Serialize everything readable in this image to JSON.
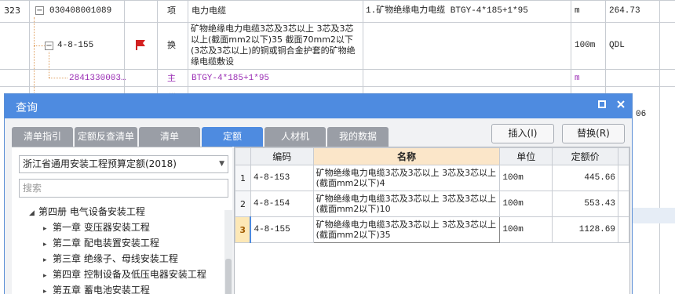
{
  "bg_rows": [
    {
      "no": "323",
      "code": "030408001089",
      "type": "项",
      "name": "电力电缆",
      "feature": "1.矿物绝缘电力电缆 BTGY-4*185+1*95",
      "unit": "m",
      "qty": "264.73"
    },
    {
      "code": "4-8-155",
      "type": "换",
      "name": "矿物绝缘电力电缆3芯及3芯以上 3芯及3芯以上(截面mm2以下)35  截面70mm2以下(3芯及3芯以上)的铜或铜合金护套的矿物绝缘电缆敷设",
      "unit": "100m",
      "qty": "QDL"
    },
    {
      "code": "2841330003…",
      "type": "主",
      "name": "BTGY-4*185+1*95",
      "unit": "m"
    }
  ],
  "bg_partial": {
    "row4_type": "…",
    "right_edge_num": "06"
  },
  "dialog": {
    "title": "查询",
    "restore_label": "▫",
    "close_label": "✕",
    "tabs": [
      "清单指引",
      "定额反查清单",
      "清单",
      "定额",
      "人材机",
      "我的数据"
    ],
    "active_tab": "定额",
    "insert_label": "插入(I)",
    "replace_label": "替换(R)",
    "quota_library": "浙江省通用安装工程预算定额(2018)",
    "search_placeholder": "搜索",
    "tree": [
      {
        "label": "第四册 电气设备安装工程",
        "level": 0,
        "expanded": true
      },
      {
        "label": "第一章 变压器安装工程",
        "level": 1
      },
      {
        "label": "第二章 配电装置安装工程",
        "level": 1
      },
      {
        "label": "第三章 绝缘子、母线安装工程",
        "level": 1
      },
      {
        "label": "第四章 控制设备及低压电器安装工程",
        "level": 1
      },
      {
        "label": "第五章 蓄电池安装工程",
        "level": 1
      }
    ],
    "table": {
      "headers": [
        "编码",
        "名称",
        "单位",
        "定额价"
      ],
      "rows": [
        {
          "num": "1",
          "code": "4-8-153",
          "name": "矿物绝缘电力电缆3芯及3芯以上 3芯及3芯以上(截面mm2以下)4",
          "unit": "100m",
          "price": "445.66"
        },
        {
          "num": "2",
          "code": "4-8-154",
          "name": "矿物绝缘电力电缆3芯及3芯以上 3芯及3芯以上(截面mm2以下)10",
          "unit": "100m",
          "price": "553.43"
        },
        {
          "num": "3",
          "code": "4-8-155",
          "name": "矿物绝缘电力电缆3芯及3芯以上 3芯及3芯以上(截面mm2以下)35",
          "unit": "100m",
          "price": "1128.69",
          "selected": true
        }
      ]
    }
  },
  "colors": {
    "accent": "#4e8be0",
    "tab_inactive": "#9a9ea6",
    "purple_text": "#9b2fb5",
    "selected_row": "#fde8b6"
  }
}
